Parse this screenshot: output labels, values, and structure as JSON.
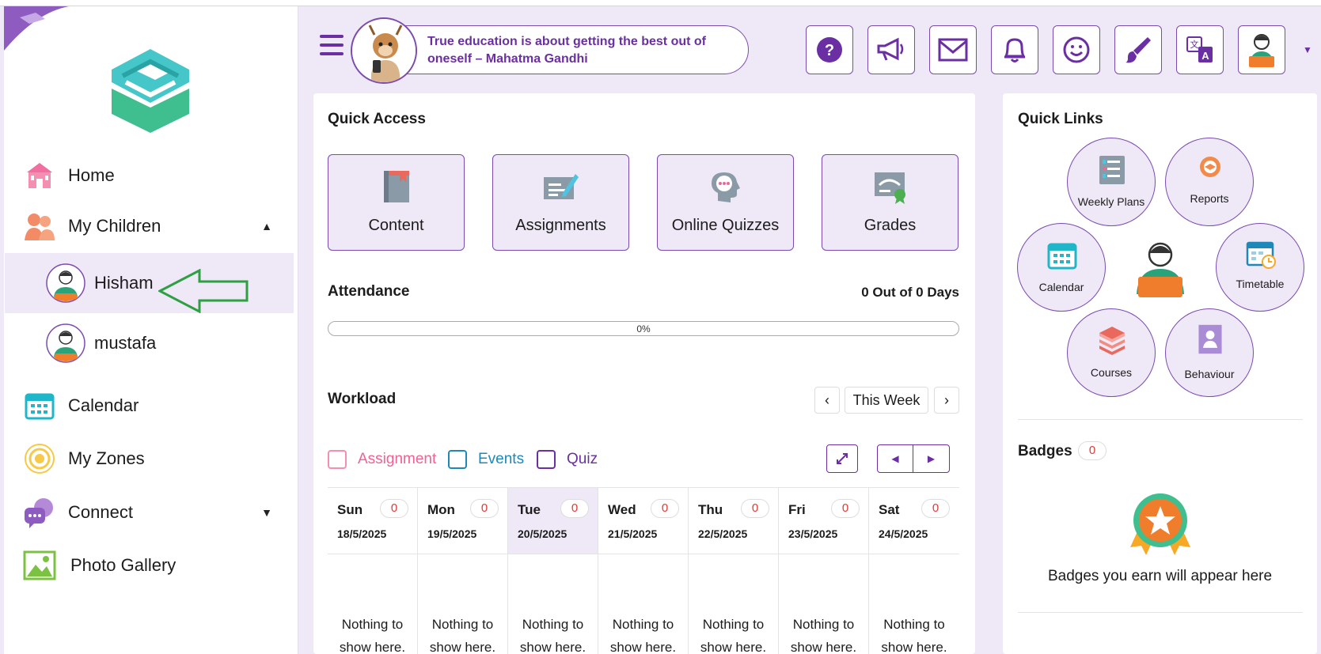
{
  "sidebar": {
    "nav": [
      {
        "label": "Home",
        "icon": "home-icon"
      },
      {
        "label": "My Children",
        "icon": "children-icon"
      },
      {
        "label": "Calendar",
        "icon": "calendar-icon"
      },
      {
        "label": "My Zones",
        "icon": "zones-icon"
      },
      {
        "label": "Connect",
        "icon": "connect-icon"
      },
      {
        "label": "Photo Gallery",
        "icon": "photo-gallery-icon"
      }
    ],
    "children": [
      {
        "name": "Hisham",
        "active": true
      },
      {
        "name": "mustafa",
        "active": false
      }
    ]
  },
  "header": {
    "quote": "True education is about getting the best out of oneself – Mahatma Gandhi",
    "buttons": [
      "help-icon",
      "announcement-icon",
      "mail-icon",
      "bell-icon",
      "smiley-icon",
      "brush-icon",
      "translate-icon",
      "profile-avatar-icon"
    ]
  },
  "quick_access": {
    "title": "Quick Access",
    "tiles": [
      {
        "label": "Content",
        "icon": "book-icon"
      },
      {
        "label": "Assignments",
        "icon": "assignment-icon"
      },
      {
        "label": "Online Quizzes",
        "icon": "quiz-icon"
      },
      {
        "label": "Grades",
        "icon": "grades-icon"
      }
    ]
  },
  "attendance": {
    "title": "Attendance",
    "count_text": "0 Out of 0 Days",
    "progress_percent": 0,
    "progress_label": "0%"
  },
  "workload": {
    "title": "Workload",
    "period_label": "This Week",
    "legend": [
      {
        "label": "Assignment",
        "color": "#f06292"
      },
      {
        "label": "Events",
        "color": "#1e88b8"
      },
      {
        "label": "Quiz",
        "color": "#6a2fa2"
      }
    ],
    "days": [
      {
        "name": "Sun",
        "date": "18/5/2025",
        "count": "0",
        "today": false
      },
      {
        "name": "Mon",
        "date": "19/5/2025",
        "count": "0",
        "today": false
      },
      {
        "name": "Tue",
        "date": "20/5/2025",
        "count": "0",
        "today": true
      },
      {
        "name": "Wed",
        "date": "21/5/2025",
        "count": "0",
        "today": false
      },
      {
        "name": "Thu",
        "date": "22/5/2025",
        "count": "0",
        "today": false
      },
      {
        "name": "Fri",
        "date": "23/5/2025",
        "count": "0",
        "today": false
      },
      {
        "name": "Sat",
        "date": "24/5/2025",
        "count": "0",
        "today": false
      }
    ],
    "empty_line1": "Nothing to",
    "empty_line2": "show here."
  },
  "quick_links": {
    "title": "Quick Links",
    "items": [
      {
        "label": "Weekly Plans",
        "icon": "weekly-plans-icon"
      },
      {
        "label": "Reports",
        "icon": "reports-icon"
      },
      {
        "label": "Calendar",
        "icon": "calendar-icon"
      },
      {
        "label": "Timetable",
        "icon": "timetable-icon"
      },
      {
        "label": "Courses",
        "icon": "courses-icon"
      },
      {
        "label": "Behaviour",
        "icon": "behaviour-icon"
      }
    ]
  },
  "badges": {
    "title": "Badges",
    "count": "0",
    "empty_text": "Badges you earn will appear here"
  },
  "colors": {
    "accent": "#6a2fa2",
    "accent_light": "#efe8f6",
    "badge_red": "#e53935",
    "annotation_arrow": "#2ea043"
  }
}
